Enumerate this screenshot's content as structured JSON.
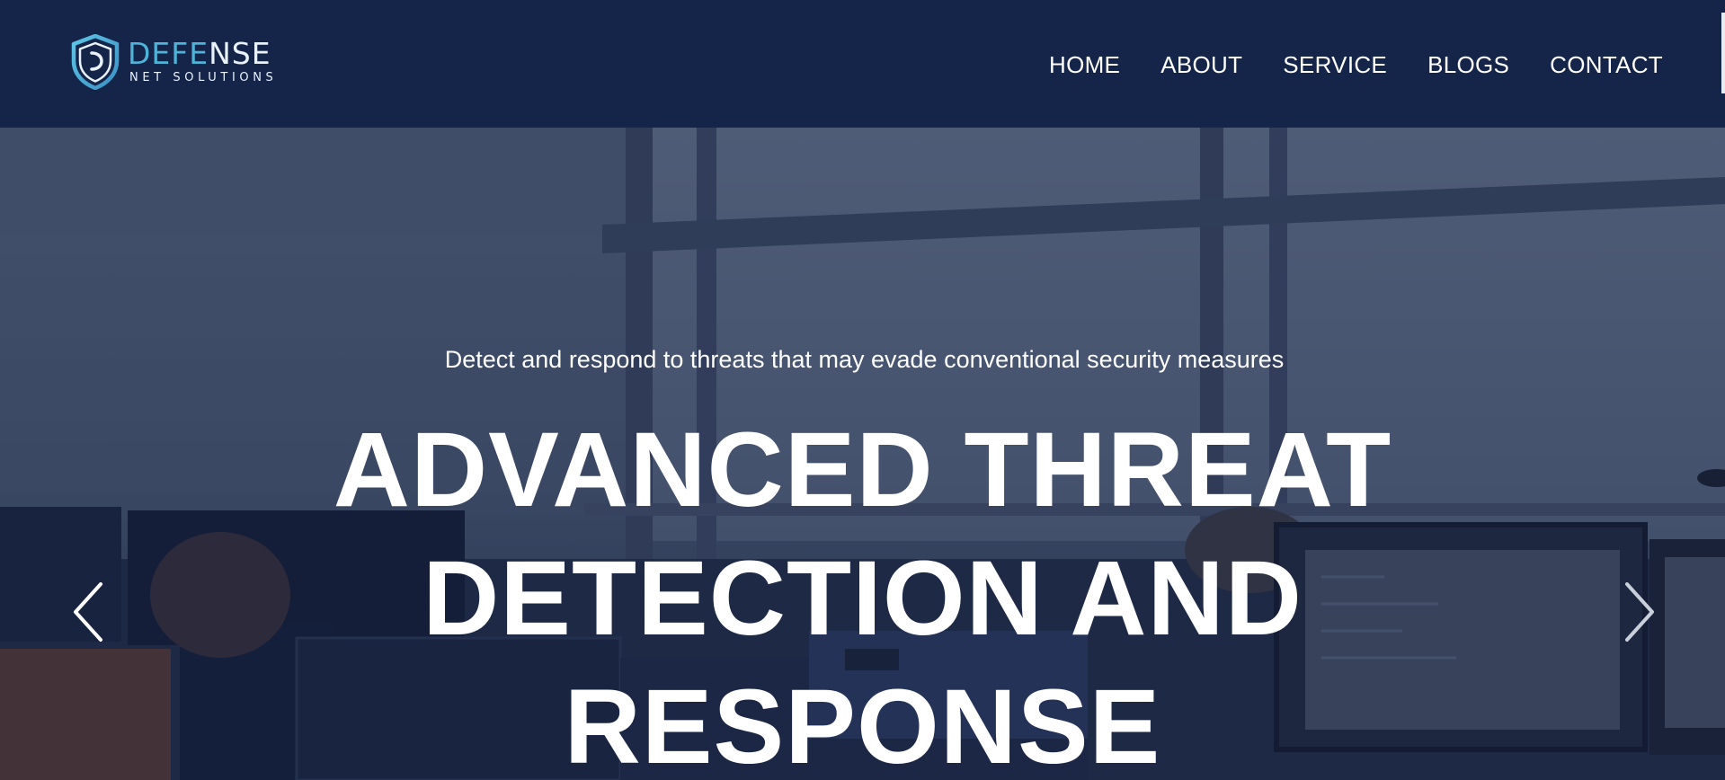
{
  "brand": {
    "title_main": "DEFE",
    "title_tail": "NSE",
    "subtitle": "NET SOLUTIONS",
    "accent_color": "#4fb3d9",
    "icon": "shield-icon"
  },
  "nav": {
    "items": [
      {
        "label": "HOME"
      },
      {
        "label": "ABOUT"
      },
      {
        "label": "SERVICE"
      },
      {
        "label": "BLOGS"
      },
      {
        "label": "CONTACT"
      }
    ]
  },
  "hero": {
    "subtitle": "Detect and respond to threats that may evade conventional security measures",
    "title_lines": [
      "ADVANCED THREAT",
      "DETECTION AND",
      "RESPONSE"
    ],
    "prev_icon": "chevron-left-icon",
    "next_icon": "chevron-right-icon"
  },
  "colors": {
    "header_bg": "#152449",
    "text": "#ffffff"
  }
}
